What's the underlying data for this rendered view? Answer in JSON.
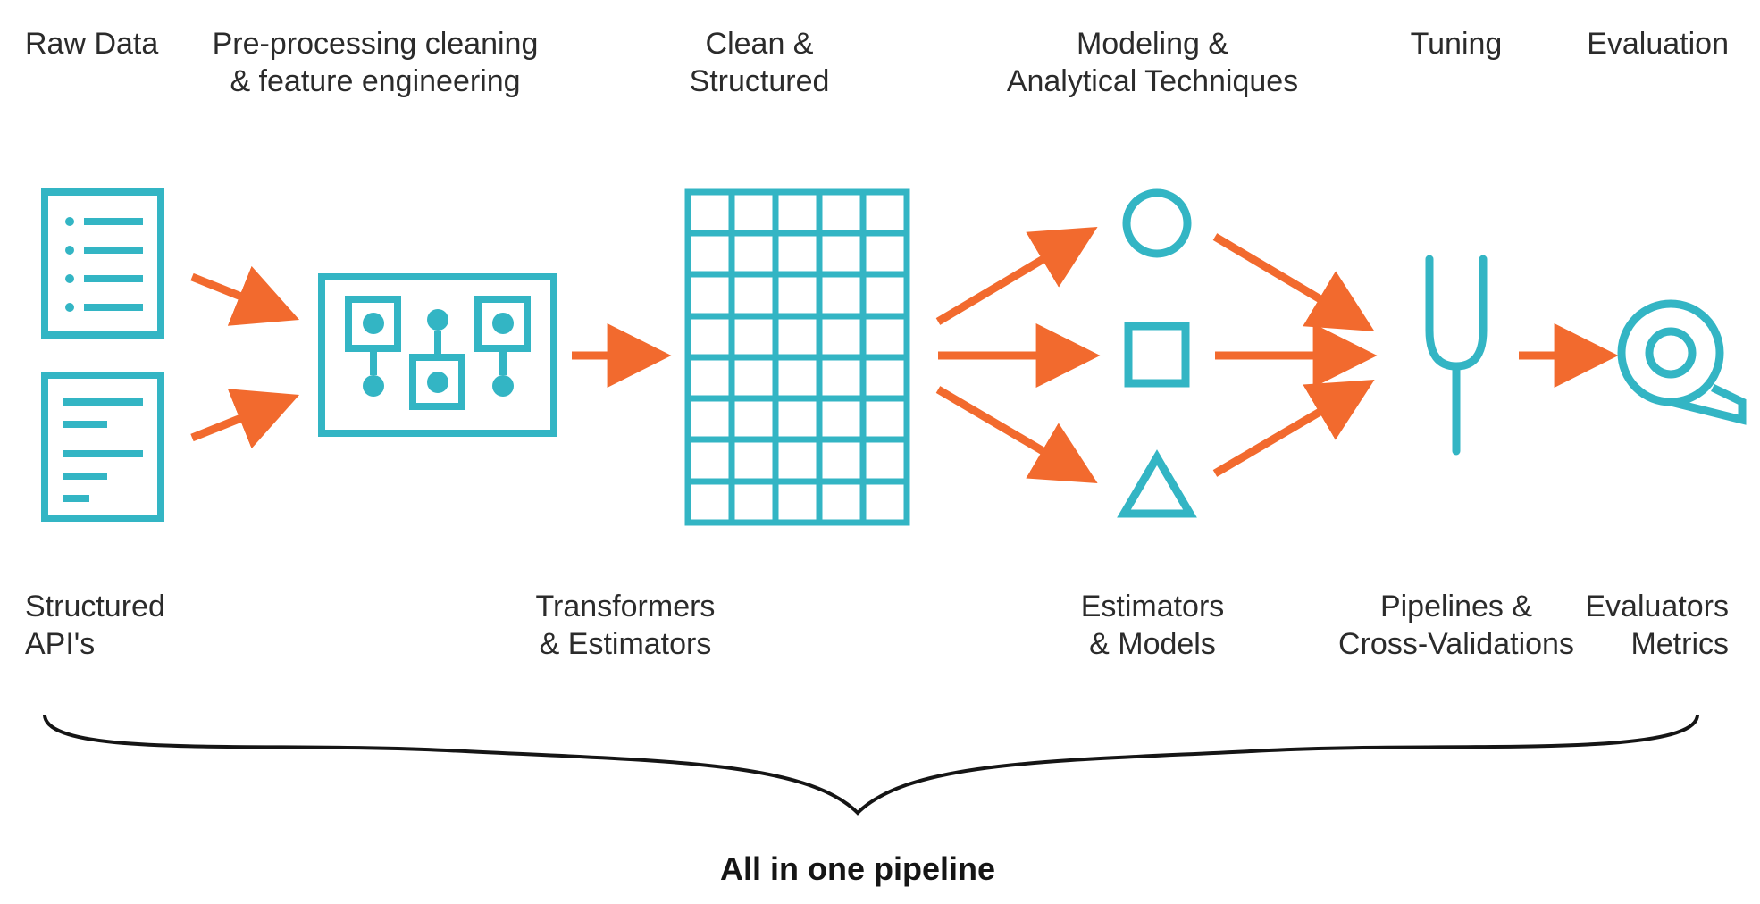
{
  "colors": {
    "teal": "#33b5c4",
    "orange": "#f26a2e",
    "text": "#2b2b2b",
    "black": "#151515"
  },
  "labels": {
    "top": {
      "raw_data": "Raw Data",
      "preprocessing_l1": "Pre-processing cleaning",
      "preprocessing_l2": "& feature engineering",
      "clean_l1": "Clean &",
      "clean_l2": "Structured",
      "modeling_l1": "Modeling &",
      "modeling_l2": "Analytical Techniques",
      "tuning": "Tuning",
      "evaluation": "Evaluation"
    },
    "bottom": {
      "structured_l1": "Structured",
      "structured_l2": "API's",
      "transformers_l1": "Transformers",
      "transformers_l2": "& Estimators",
      "estimators_l1": "Estimators",
      "estimators_l2": "& Models",
      "pipelines_l1": "Pipelines &",
      "pipelines_l2": "Cross-Validations",
      "evaluators_l1": "Evaluators",
      "evaluators_l2": "Metrics"
    },
    "footer": "All in one pipeline"
  }
}
